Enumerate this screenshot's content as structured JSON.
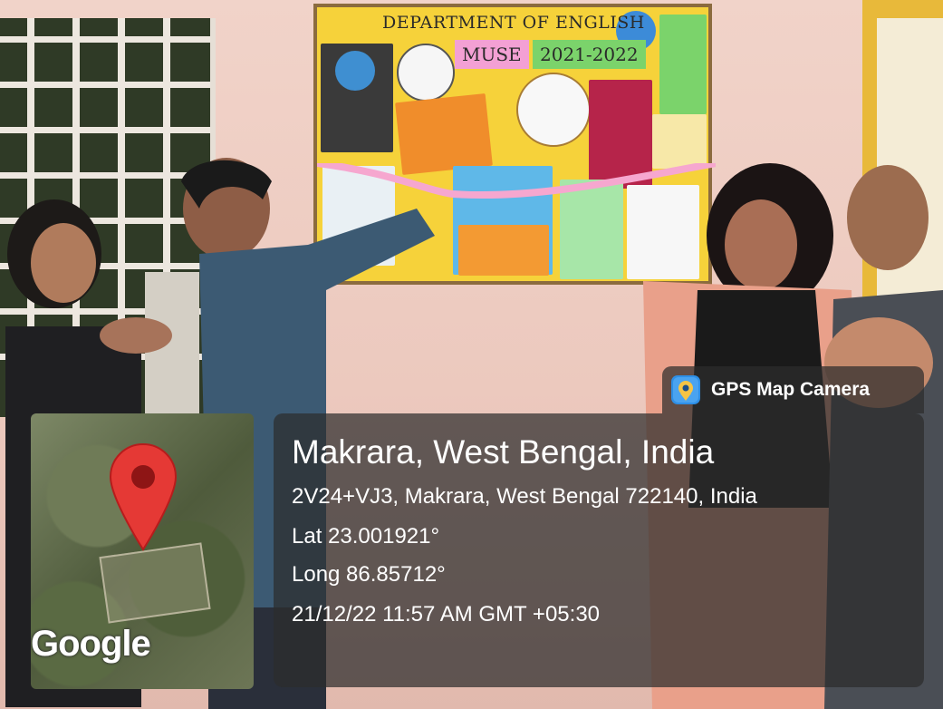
{
  "poster": {
    "department": "DEPARTMENT OF ENGLISH",
    "name": "MUSE",
    "year": "2021-2022"
  },
  "badge": {
    "app_name": "GPS Map Camera",
    "icon": "camera-pin-icon"
  },
  "map": {
    "provider_logo": "Google",
    "pin_color": "#e53935"
  },
  "location": {
    "place": "Makrara, West Bengal, India",
    "address": "2V24+VJ3, Makrara, West Bengal 722140, India",
    "latitude": "Lat 23.001921°",
    "longitude": "Long 86.85712°",
    "datetime": "21/12/22 11:57 AM GMT +05:30"
  }
}
